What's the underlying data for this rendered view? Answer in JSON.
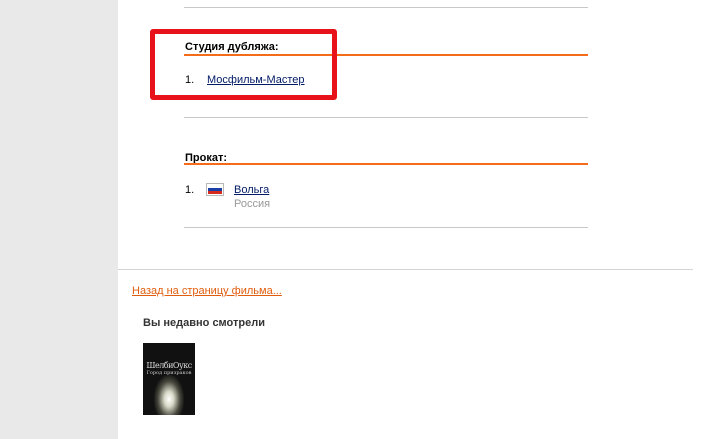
{
  "dubbing_section": {
    "title": "Студия дубляжа:",
    "items": [
      {
        "num": "1.",
        "name": "Мосфильм-Мастер"
      }
    ]
  },
  "distribution_section": {
    "title": "Прокат:",
    "items": [
      {
        "num": "1.",
        "name": "Вольга",
        "country": "Россия",
        "flag": "russia-flag-icon"
      }
    ]
  },
  "back_link": "Назад на страницу фильма...",
  "recently_viewed": {
    "title": "Вы недавно смотрели",
    "posters": [
      {
        "top_text": "",
        "title": "ШелбиОукс",
        "subtitle": "Город призраков"
      }
    ]
  },
  "colors": {
    "accent_orange": "#f26c1a",
    "highlight_red": "#e8121b",
    "link_blue": "#001a66",
    "flag_white": "#ffffff",
    "flag_blue": "#1a3fa8",
    "flag_red": "#d52b1e"
  }
}
